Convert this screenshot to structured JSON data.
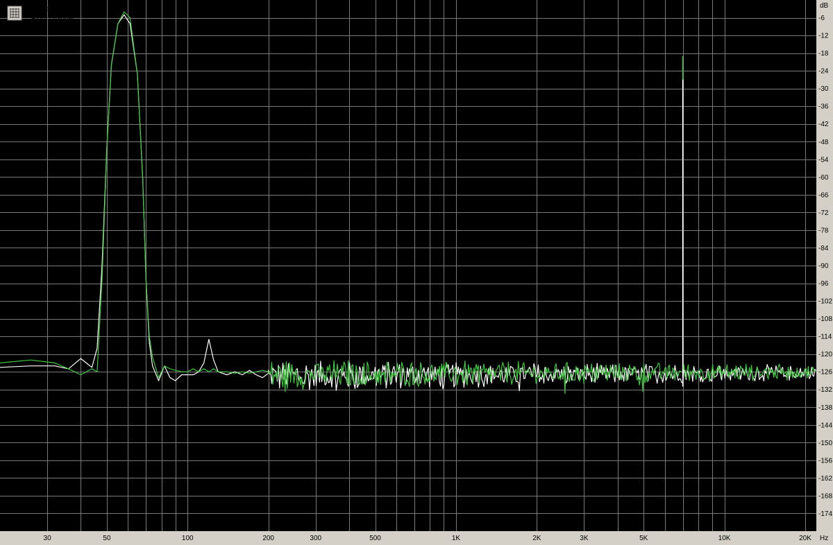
{
  "chart_data": {
    "type": "line",
    "xscale": "log",
    "xlim": [
      20,
      22000
    ],
    "ylim": [
      -180,
      0
    ],
    "grid": true,
    "legend_position": "top-left",
    "xunit": "Hz",
    "yunit": "dB",
    "xticks": [
      {
        "v": 30,
        "label": "30"
      },
      {
        "v": 50,
        "label": "50"
      },
      {
        "v": 100,
        "label": "100"
      },
      {
        "v": 200,
        "label": "200"
      },
      {
        "v": 300,
        "label": "300"
      },
      {
        "v": 500,
        "label": "500"
      },
      {
        "v": 1000,
        "label": "1K"
      },
      {
        "v": 2000,
        "label": "2K"
      },
      {
        "v": 3000,
        "label": "3K"
      },
      {
        "v": 5000,
        "label": "5K"
      },
      {
        "v": 10000,
        "label": "10K"
      },
      {
        "v": 20000,
        "label": "20K"
      }
    ],
    "xgrid": [
      30,
      40,
      50,
      60,
      70,
      80,
      90,
      100,
      200,
      300,
      400,
      500,
      600,
      700,
      800,
      900,
      1000,
      2000,
      3000,
      4000,
      5000,
      6000,
      7000,
      8000,
      9000,
      10000,
      20000
    ],
    "yticks": [
      -6,
      -12,
      -18,
      -24,
      -30,
      -36,
      -42,
      -48,
      -54,
      -60,
      -66,
      -72,
      -78,
      -84,
      -90,
      -96,
      -102,
      -108,
      -114,
      -120,
      -126,
      -132,
      -138,
      -144,
      -150,
      -156,
      -162,
      -168,
      -174
    ],
    "series": [
      {
        "name": "Left channel",
        "color": "#ffffff",
        "points": [
          [
            20,
            -124.5
          ],
          [
            26,
            -124
          ],
          [
            32,
            -124
          ],
          [
            36,
            -125
          ],
          [
            40,
            -121.5
          ],
          [
            44,
            -124.5
          ],
          [
            46,
            -118
          ],
          [
            48,
            -90
          ],
          [
            50,
            -50
          ],
          [
            52,
            -22
          ],
          [
            55,
            -8
          ],
          [
            58,
            -5
          ],
          [
            61,
            -8
          ],
          [
            65,
            -25
          ],
          [
            68,
            -60
          ],
          [
            70,
            -95
          ],
          [
            72,
            -116
          ],
          [
            74,
            -124
          ],
          [
            78,
            -129
          ],
          [
            82,
            -124
          ],
          [
            86,
            -128
          ],
          [
            90,
            -129
          ],
          [
            95,
            -127
          ],
          [
            100,
            -127
          ],
          [
            105,
            -127
          ],
          [
            110,
            -126
          ],
          [
            115,
            -123
          ],
          [
            120,
            -115
          ],
          [
            125,
            -122
          ],
          [
            130,
            -126
          ],
          [
            140,
            -127
          ],
          [
            150,
            -126
          ],
          [
            160,
            -127
          ],
          [
            170,
            -125.5
          ],
          [
            180,
            -127
          ],
          [
            190,
            -128
          ],
          [
            200,
            -126.5
          ]
        ]
      },
      {
        "name": "Right channel",
        "color": "#3cc83c",
        "points": [
          [
            20,
            -123
          ],
          [
            26,
            -122
          ],
          [
            32,
            -123
          ],
          [
            36,
            -125
          ],
          [
            40,
            -127
          ],
          [
            44,
            -125
          ],
          [
            46,
            -126
          ],
          [
            48,
            -95
          ],
          [
            50,
            -50
          ],
          [
            52,
            -22
          ],
          [
            55,
            -8
          ],
          [
            58,
            -4
          ],
          [
            61,
            -6
          ],
          [
            65,
            -25
          ],
          [
            68,
            -60
          ],
          [
            70,
            -95
          ],
          [
            72,
            -114
          ],
          [
            74,
            -121
          ],
          [
            78,
            -128
          ],
          [
            82,
            -124
          ],
          [
            86,
            -125
          ],
          [
            90,
            -125.5
          ],
          [
            95,
            -126
          ],
          [
            100,
            -126
          ],
          [
            105,
            -125
          ],
          [
            110,
            -126
          ],
          [
            115,
            -125
          ],
          [
            120,
            -126
          ],
          [
            125,
            -125
          ],
          [
            130,
            -126
          ],
          [
            140,
            -126
          ],
          [
            150,
            -126.5
          ],
          [
            160,
            -126
          ],
          [
            170,
            -126.5
          ],
          [
            180,
            -126
          ],
          [
            190,
            -125.5
          ],
          [
            200,
            -126
          ]
        ]
      }
    ],
    "noise_floor": {
      "from": 200,
      "to": 22000,
      "level_start": -127,
      "level_end": -126
    },
    "spikes": [
      {
        "series": "Right channel",
        "freq": 7000,
        "level": -19
      },
      {
        "series": "Left channel",
        "freq": 7000,
        "level": -27
      }
    ]
  }
}
